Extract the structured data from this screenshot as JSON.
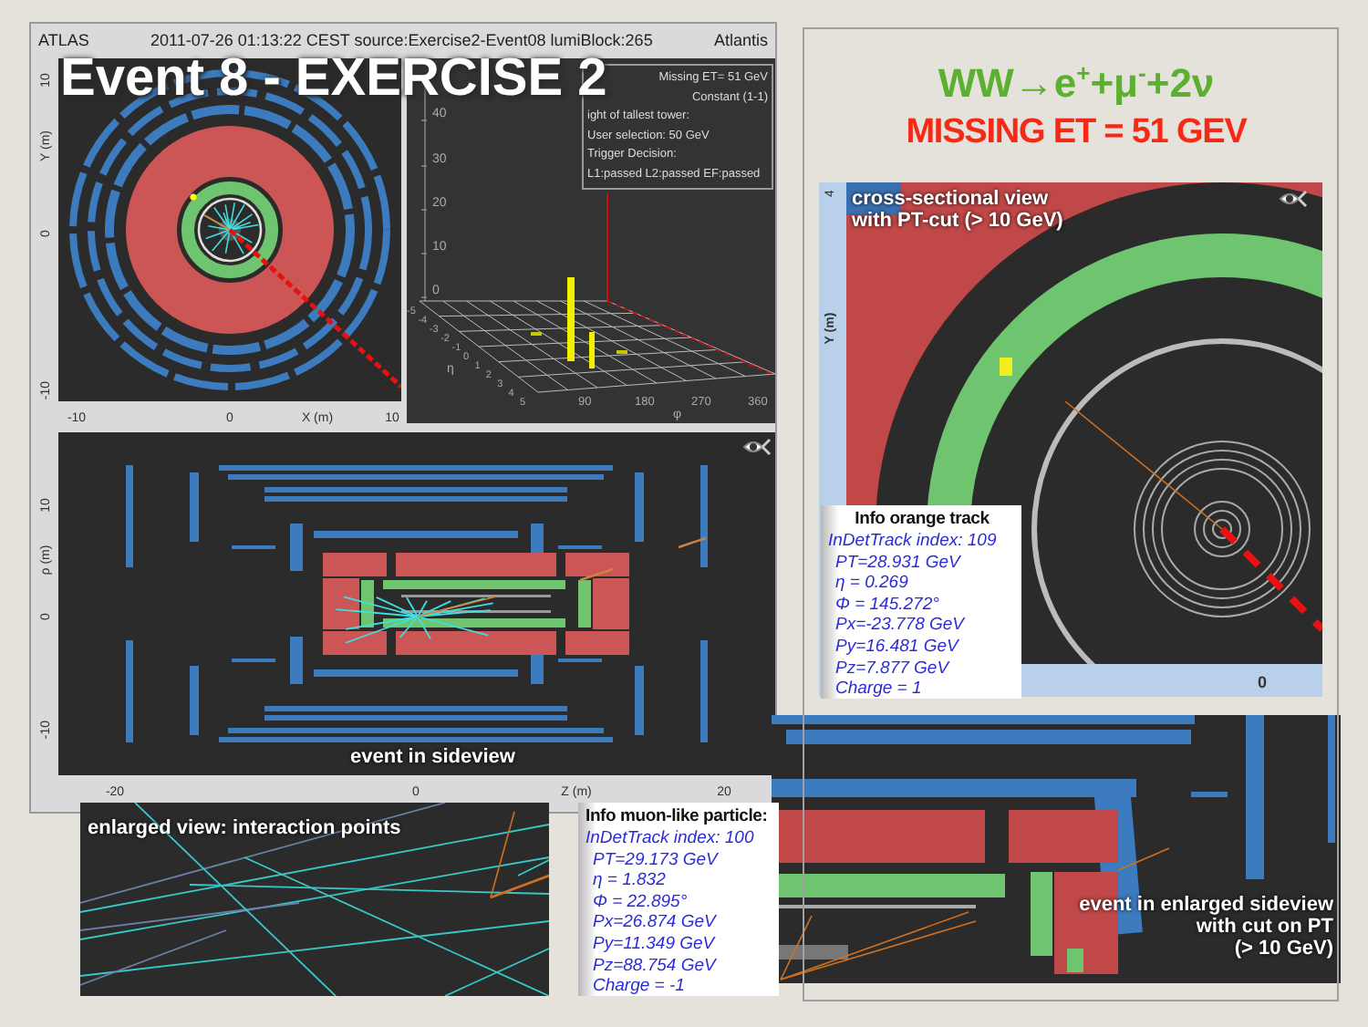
{
  "header": {
    "experiment": "ATLAS",
    "event_info": "2011-07-26 01:13:22 CEST source:Exercise2-Event08 lumiBlock:265",
    "software": "Atlantis"
  },
  "title": "Event 8 - EXERCISE 2",
  "process": "WW→e$^{+}$+μ$^{-}$+2ν",
  "missing_et": "MISSING ET = 51 GEV",
  "xy_view": {
    "y_label": "Y (m)",
    "y_ticks": [
      "10",
      "0",
      "-10"
    ],
    "x_label": "X (m)",
    "x_ticks": [
      "-10",
      "0",
      "10"
    ]
  },
  "lego_plot": {
    "legend": [
      "Missing ET= 51 GeV",
      "Constant (1-1)",
      "ight of tallest tower:",
      "User selection: 50 GeV",
      "Trigger Decision:",
      "L1:passed L2:passed EF:passed"
    ],
    "z_ticks": [
      "40",
      "30",
      "20",
      "10",
      "0"
    ],
    "phi_ticks": [
      "90",
      "180",
      "270",
      "360"
    ],
    "phi_label": "φ",
    "eta_ticks": [
      "-5",
      "-4",
      "-3",
      "-2",
      "-1",
      "0",
      "1",
      "2",
      "3",
      "4",
      "5"
    ],
    "eta_label": "η"
  },
  "side_view": {
    "caption": "event in sideview",
    "y_label": "ρ (m)",
    "y_ticks": [
      "10",
      "0",
      "-10"
    ],
    "x_label": "Z (m)",
    "x_ticks": [
      "-20",
      "0",
      "20"
    ]
  },
  "interaction_view": {
    "caption": "enlarged view: interaction points"
  },
  "muon_info": {
    "title": "Info muon-like particle:",
    "lines": [
      "InDetTrack index: 100",
      "PT=29.173 GeV",
      "η = 1.832",
      "Φ = 22.895°",
      "Px=26.874 GeV",
      "Py=11.349 GeV",
      "Pz=88.754 GeV",
      "Charge = -1"
    ]
  },
  "cross_section_view": {
    "caption": [
      "cross-sectional view",
      "with PT-cut  (> 10 GeV)"
    ],
    "y_label": "Y (m)",
    "y_ticks": [
      "4"
    ],
    "x_ticks": [
      "0"
    ]
  },
  "orange_track_info": {
    "title": "Info orange track",
    "lines": [
      "InDetTrack index: 109",
      "PT=28.931 GeV",
      "η = 0.269",
      "Φ = 145.272°",
      "Px=-23.778 GeV",
      "Py=16.481 GeV",
      "Pz=7.877 GeV",
      "Charge = 1"
    ]
  },
  "enlarged_side_view": {
    "caption": [
      "event in enlarged sideview",
      "with cut on PT",
      "(> 10 GeV)"
    ]
  }
}
